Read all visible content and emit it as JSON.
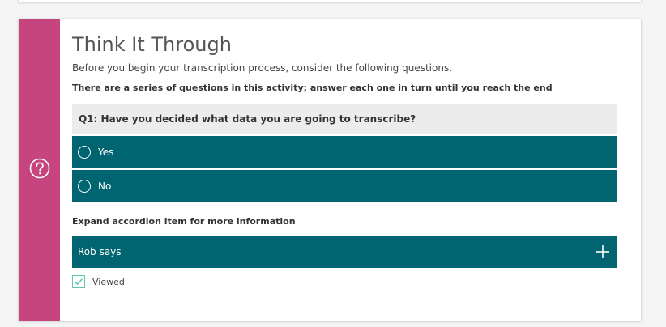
{
  "block": {
    "title": "Think It Through",
    "intro": "Before you begin your transcription process, consider the following questions.",
    "instruction": "There are a series of questions in this activity; answer each one in turn until you reach the end",
    "side_color": "#c7457f",
    "side_icon": "question-circle-icon"
  },
  "question": {
    "text": "Q1: Have you decided what data you are going to transcribe?",
    "options": [
      {
        "label": "Yes",
        "selected": false
      },
      {
        "label": "No",
        "selected": false
      }
    ]
  },
  "accordion": {
    "hint": "Expand accordion item for more information",
    "item_label": "Rob says",
    "expand_icon": "plus-icon"
  },
  "completion": {
    "label": "Viewed",
    "checked": true,
    "icon": "checkmark-icon"
  },
  "colors": {
    "accent": "#006570",
    "question_bg": "#ececec",
    "check": "#5fc7b0"
  }
}
